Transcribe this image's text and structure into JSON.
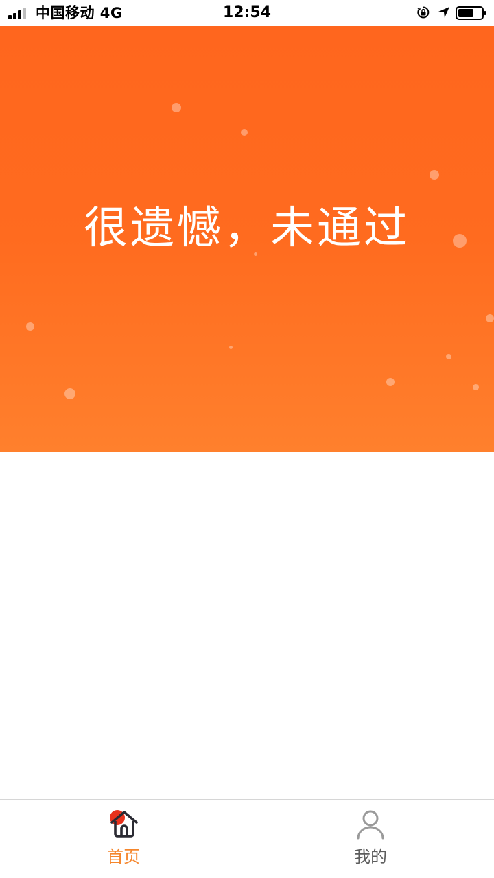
{
  "status_bar": {
    "carrier": "中国移动  4G",
    "time": "12:54",
    "icons": [
      "signal-icon",
      "rotation-lock-icon",
      "location-icon",
      "battery-icon"
    ]
  },
  "banner": {
    "result_text": "很遗憾，未通过",
    "colors": {
      "gradient_top": "#ff661e",
      "gradient_bottom": "#ff802d",
      "text": "#ffffff"
    }
  },
  "tab_bar": {
    "tabs": [
      {
        "label": "首页",
        "icon": "home-icon",
        "active": true,
        "color": "#f5862c"
      },
      {
        "label": "我的",
        "icon": "user-icon",
        "active": false,
        "color": "#5e5e5e"
      }
    ]
  }
}
